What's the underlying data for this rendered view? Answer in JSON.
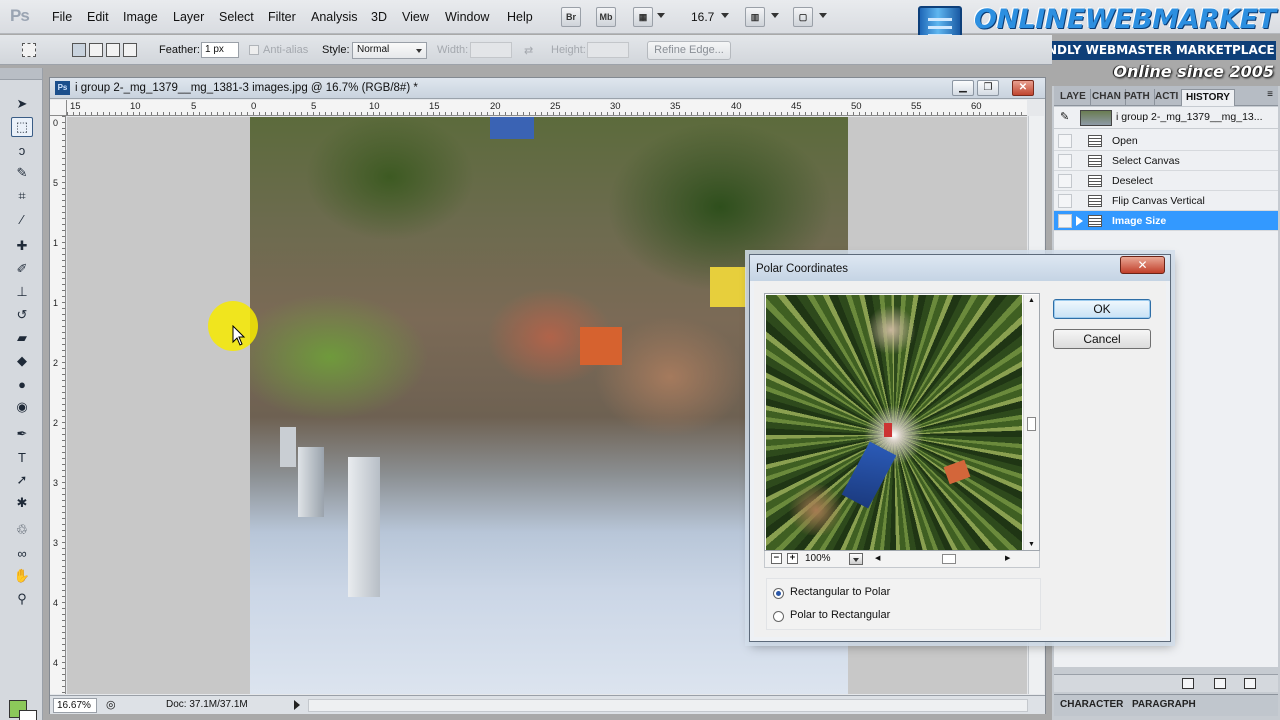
{
  "app": {
    "logo": "Ps"
  },
  "menu": [
    "File",
    "Edit",
    "Image",
    "Layer",
    "Select",
    "Filter",
    "Analysis",
    "3D",
    "View",
    "Window",
    "Help"
  ],
  "menubar_widgets": {
    "bridge": "Br",
    "minibridge": "Mb",
    "zoom": "16.7"
  },
  "brand": {
    "name": "ONLINEWEBMARKET",
    "tagline": "YOUR FRIENDLY WEBMASTER MARKETPLACE",
    "since": "Online since 2005"
  },
  "options": {
    "feather_label": "Feather:",
    "feather_value": "1 px",
    "antialias_label": "Anti-alias",
    "style_label": "Style:",
    "style_value": "Normal",
    "width_label": "Width:",
    "height_label": "Height:",
    "refine_edge": "Refine Edge..."
  },
  "document": {
    "badge": "Ps",
    "title": "i group 2-_mg_1379__mg_1381-3 images.jpg @ 16.7% (RGB/8#) *",
    "ruler_h": [
      "15",
      "10",
      "5",
      "0",
      "5",
      "10",
      "15",
      "20",
      "25",
      "30",
      "35",
      "40",
      "45",
      "50",
      "55",
      "60"
    ],
    "ruler_v": [
      "0",
      "5",
      "1",
      "1",
      "2",
      "2",
      "3",
      "3",
      "4",
      "4"
    ],
    "status_zoom": "16.67%",
    "status_doc": "Doc: 37.1M/37.1M"
  },
  "panels": {
    "tabs": [
      "LAYE",
      "CHAN",
      "PATH",
      "ACTI",
      "HISTORY"
    ],
    "snapshot": "i group 2-_mg_1379__mg_13...",
    "history": [
      {
        "label": "Open",
        "selected": false
      },
      {
        "label": "Select Canvas",
        "selected": false
      },
      {
        "label": "Deselect",
        "selected": false
      },
      {
        "label": "Flip Canvas Vertical",
        "selected": false
      },
      {
        "label": "Image Size",
        "selected": true
      }
    ],
    "bottom_tabs": [
      "CHARACTER",
      "PARAGRAPH"
    ]
  },
  "dialog": {
    "title": "Polar Coordinates",
    "close_glyph": "✕",
    "ok": "OK",
    "cancel": "Cancel",
    "preview_zoom": "100%",
    "options": [
      {
        "label": "Rectangular to Polar",
        "selected": true
      },
      {
        "label": "Polar to Rectangular",
        "selected": false
      }
    ]
  },
  "colors": {
    "foreground": "#8cc85a",
    "background": "#ffffff",
    "history_selected": "#3399ff"
  },
  "icons": {
    "tools": [
      "move-icon",
      "marquee-icon",
      "lasso-icon",
      "quick-select-icon",
      "crop-icon",
      "eyedropper-icon",
      "healing-icon",
      "brush-icon",
      "stamp-icon",
      "history-brush-icon",
      "eraser-icon",
      "bucket-icon",
      "blur-icon",
      "dodge-icon",
      "pen-icon",
      "type-icon",
      "path-select-icon",
      "shape-icon",
      "3d-rotate-icon",
      "3d-orbit-icon",
      "hand-icon",
      "zoom-icon"
    ]
  }
}
